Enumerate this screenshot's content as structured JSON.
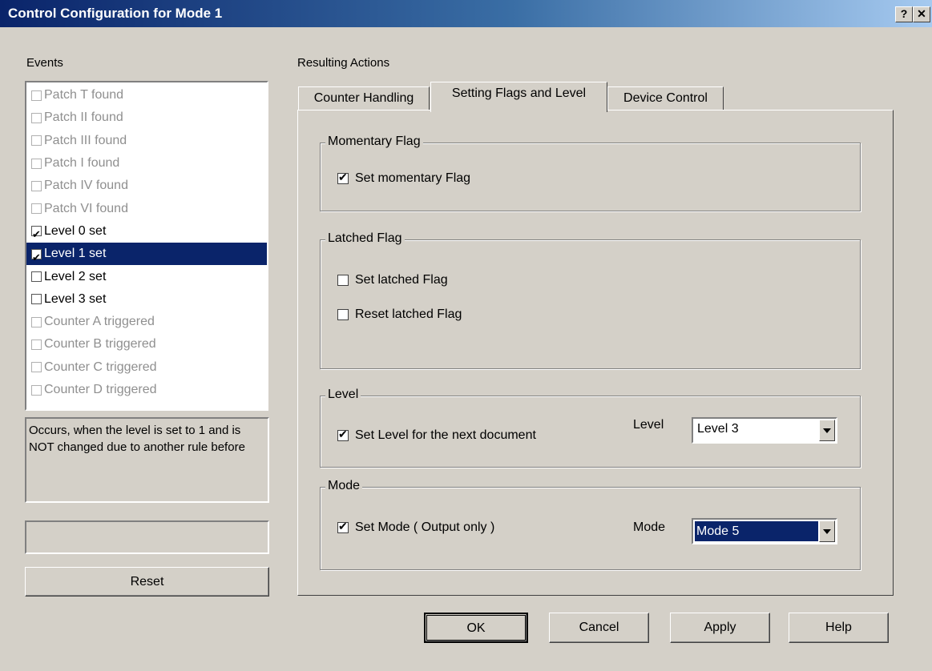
{
  "window": {
    "title": "Control Configuration for Mode 1",
    "help_glyph": "?",
    "close_glyph": "✕"
  },
  "events": {
    "label": "Events",
    "items": [
      {
        "label": "Patch T found",
        "checked": false,
        "enabled": false,
        "selected": false
      },
      {
        "label": "Patch II found",
        "checked": false,
        "enabled": false,
        "selected": false
      },
      {
        "label": "Patch III found",
        "checked": false,
        "enabled": false,
        "selected": false
      },
      {
        "label": "Patch I found",
        "checked": false,
        "enabled": false,
        "selected": false
      },
      {
        "label": "Patch IV found",
        "checked": false,
        "enabled": false,
        "selected": false
      },
      {
        "label": "Patch VI found",
        "checked": false,
        "enabled": false,
        "selected": false
      },
      {
        "label": "Level 0 set",
        "checked": true,
        "enabled": true,
        "selected": false
      },
      {
        "label": "Level 1 set",
        "checked": true,
        "enabled": true,
        "selected": true
      },
      {
        "label": "Level 2 set",
        "checked": false,
        "enabled": true,
        "selected": false
      },
      {
        "label": "Level 3 set",
        "checked": false,
        "enabled": true,
        "selected": false
      },
      {
        "label": "Counter A triggered",
        "checked": false,
        "enabled": false,
        "selected": false
      },
      {
        "label": "Counter B triggered",
        "checked": false,
        "enabled": false,
        "selected": false
      },
      {
        "label": "Counter C triggered",
        "checked": false,
        "enabled": false,
        "selected": false
      },
      {
        "label": "Counter D triggered",
        "checked": false,
        "enabled": false,
        "selected": false
      }
    ],
    "description": "Occurs, when the level is set to 1 and is NOT changed due to another rule before",
    "status": "",
    "reset_label": "Reset"
  },
  "actions": {
    "label": "Resulting Actions",
    "tabs": [
      "Counter Handling",
      "Setting Flags and Level",
      "Device Control"
    ],
    "active_tab": 1,
    "momentary": {
      "legend": "Momentary Flag",
      "set_label": "Set momentary Flag",
      "set_checked": true
    },
    "latched": {
      "legend": "Latched Flag",
      "set_label": "Set latched Flag",
      "set_checked": false,
      "reset_label": "Reset latched Flag",
      "reset_checked": false
    },
    "level": {
      "legend": "Level",
      "check_label": "Set Level for the next document",
      "checked": true,
      "combo_label": "Level",
      "combo_value": "Level 3"
    },
    "mode": {
      "legend": "Mode",
      "check_label": "Set Mode ( Output only )",
      "checked": true,
      "combo_label": "Mode",
      "combo_value": "Mode 5"
    }
  },
  "buttons": {
    "ok": "OK",
    "cancel": "Cancel",
    "apply": "Apply",
    "help": "Help"
  },
  "colors": {
    "face": "#d4d0c8",
    "selection": "#0a246a",
    "title_start": "#0a246a"
  }
}
